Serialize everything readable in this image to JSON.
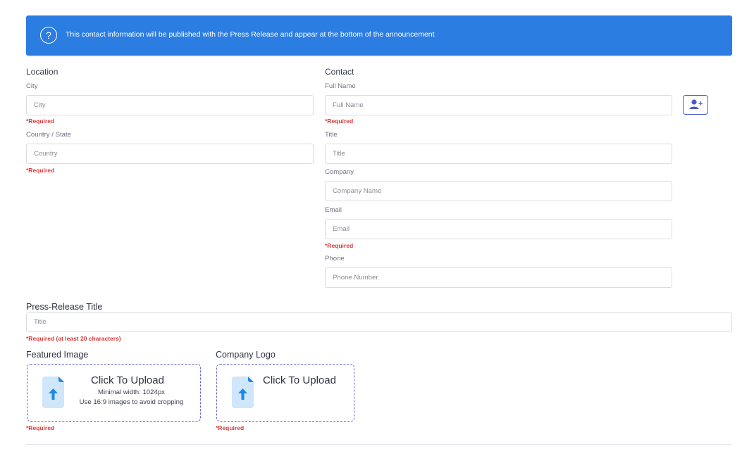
{
  "banner": {
    "icon": "help-circle-icon",
    "message": "This contact information will be published with the Press Release and appear at the bottom of the announcement"
  },
  "location": {
    "heading": "Location",
    "city": {
      "label": "City",
      "placeholder": "City",
      "required": "*Required"
    },
    "country": {
      "label": "Country / State",
      "placeholder": "Country",
      "required": "*Required"
    }
  },
  "contact": {
    "heading": "Contact",
    "full_name": {
      "label": "Full Name",
      "placeholder": "Full Name",
      "required": "*Required"
    },
    "add_contact_icon": "user-plus-icon",
    "title": {
      "label": "Title",
      "placeholder": "Title"
    },
    "company": {
      "label": "Company",
      "placeholder": "Company Name"
    },
    "email": {
      "label": "Email",
      "placeholder": "Email",
      "required": "*Required"
    },
    "phone": {
      "label": "Phone",
      "placeholder": "Phone Number"
    }
  },
  "press_release": {
    "heading": "Press-Release Title",
    "placeholder": "Title",
    "required": "*Required (at least 20 characters)"
  },
  "featured_image": {
    "heading": "Featured Image",
    "upload_title": "Click To Upload",
    "line1": "Minimal width: 1024px",
    "line2": "Use 16:9 images to avoid cropping",
    "required": "*Required",
    "icon": "file-upload-icon"
  },
  "company_logo": {
    "heading": "Company Logo",
    "upload_title": "Click To Upload",
    "required": "*Required",
    "icon": "file-upload-icon"
  },
  "colors": {
    "banner": "#2b7de1",
    "required": "#d73a3a",
    "accent": "#4b5bc4",
    "upload_icon_bg": "#cfe6fb",
    "upload_icon_fg": "#1e88e5"
  }
}
